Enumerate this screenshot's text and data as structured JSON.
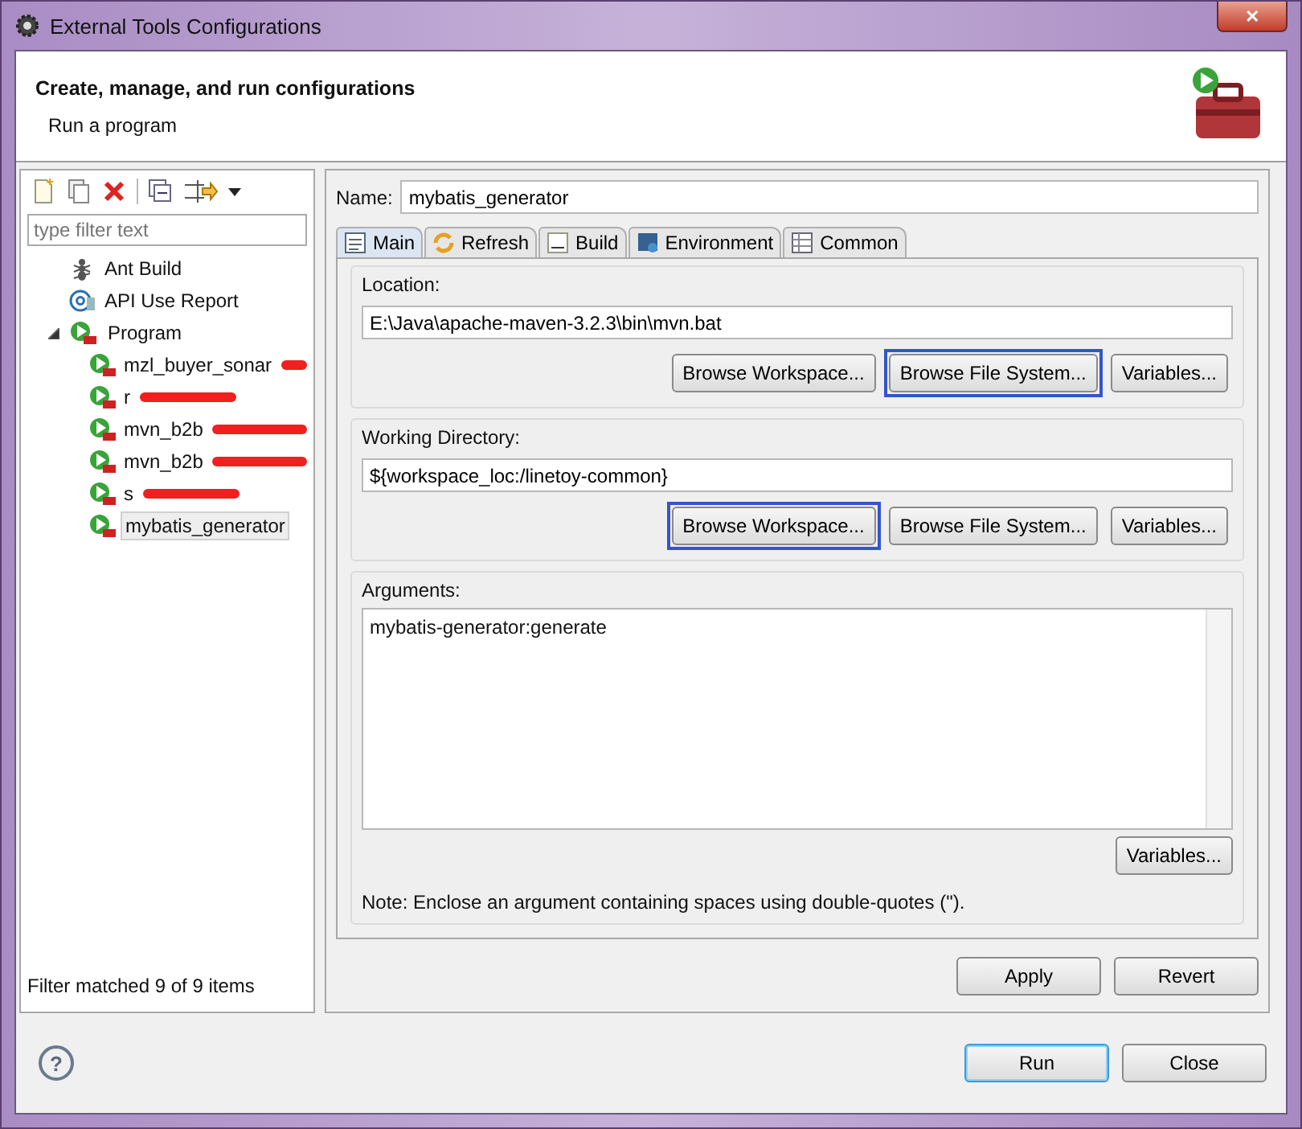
{
  "window": {
    "title": "External Tools Configurations",
    "close": "✕"
  },
  "header": {
    "title": "Create, manage, and run configurations",
    "subtitle": "Run a program"
  },
  "sidebar": {
    "filter": {
      "placeholder": "type filter text"
    },
    "tree": [
      {
        "label": "Ant Build"
      },
      {
        "label": "API Use Report"
      },
      {
        "label": "Program",
        "expanded": true,
        "children": [
          {
            "label": "mzl_buyer_sonar",
            "redacted": true,
            "selected": false
          },
          {
            "label": "r",
            "redacted": true,
            "selected": false
          },
          {
            "label": "mvn_b2b",
            "redacted": true,
            "selected": false
          },
          {
            "label": "mvn_b2b",
            "redacted": true,
            "selected": false
          },
          {
            "label": "s",
            "redacted": true,
            "selected": false
          },
          {
            "label": "mybatis_generator",
            "redacted": false,
            "selected": true
          }
        ]
      }
    ],
    "status": "Filter matched 9 of 9 items"
  },
  "name": {
    "label": "Name:",
    "value": "mybatis_generator"
  },
  "tabs": [
    {
      "label": "Main",
      "selected": true
    },
    {
      "label": "Refresh",
      "selected": false
    },
    {
      "label": "Build",
      "selected": false
    },
    {
      "label": "Environment",
      "selected": false
    },
    {
      "label": "Common",
      "selected": false
    }
  ],
  "location": {
    "label": "Location:",
    "value": "E:\\Java\\apache-maven-3.2.3\\bin\\mvn.bat",
    "buttons": [
      {
        "label": "Browse Workspace...",
        "highlighted": false
      },
      {
        "label": "Browse File System...",
        "highlighted": true
      },
      {
        "label": "Variables...",
        "highlighted": false
      }
    ]
  },
  "working_directory": {
    "label": "Working Directory:",
    "value": "${workspace_loc:/linetoy-common}",
    "buttons": [
      {
        "label": "Browse Workspace...",
        "highlighted": true
      },
      {
        "label": "Browse File System...",
        "highlighted": false
      },
      {
        "label": "Variables...",
        "highlighted": false
      }
    ]
  },
  "arguments": {
    "label": "Arguments:",
    "value": "mybatis-generator:generate",
    "button": "Variables...",
    "note": "Note: Enclose an argument containing spaces using double-quotes (\")."
  },
  "actions": [
    "Apply",
    "Revert"
  ],
  "footer": {
    "help": "?",
    "buttons": [
      {
        "label": "Run",
        "default": true
      },
      {
        "label": "Close",
        "default": false
      }
    ]
  }
}
